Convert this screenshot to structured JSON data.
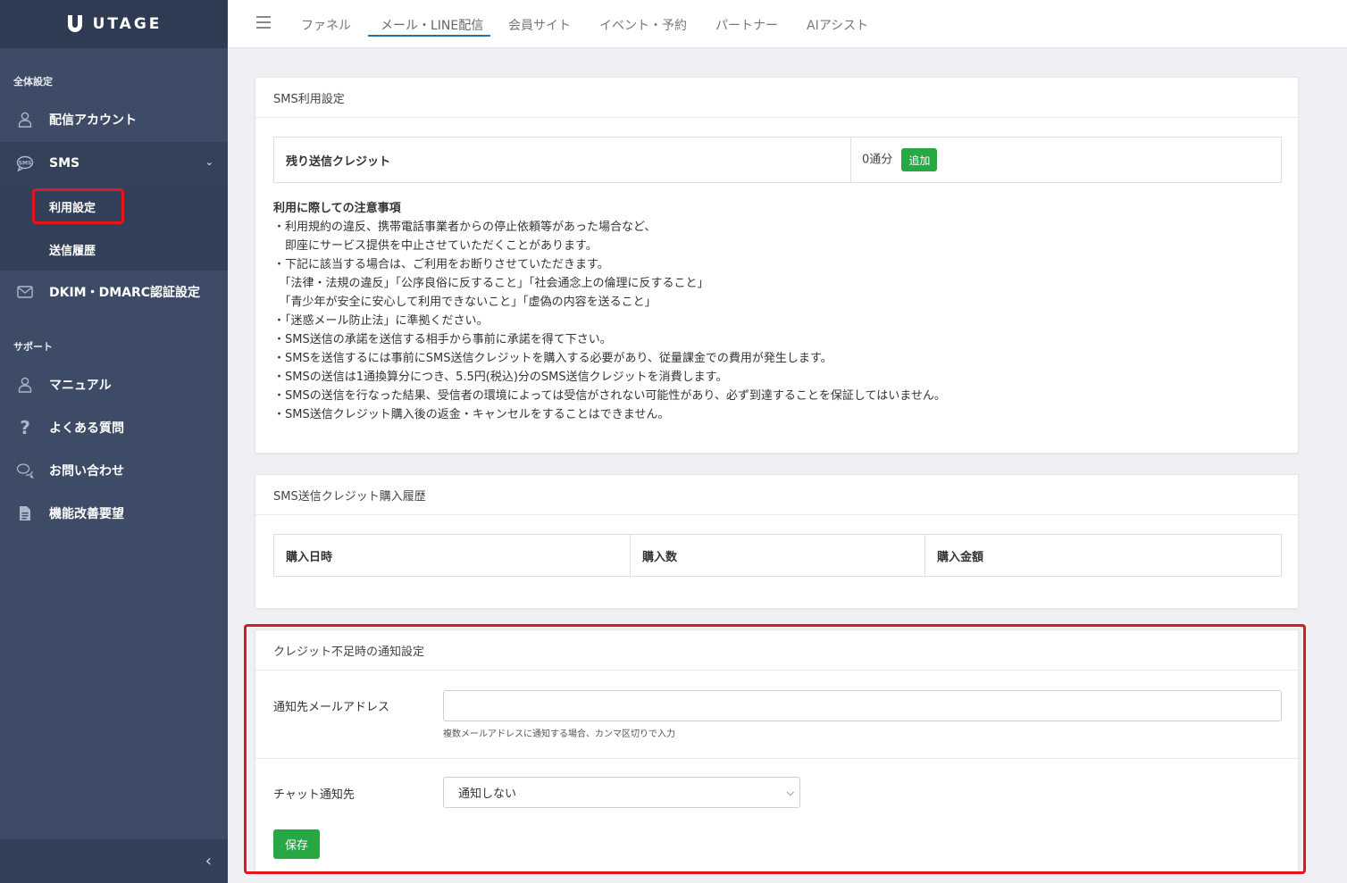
{
  "app": {
    "logo_text": "UTAGE"
  },
  "sidebar": {
    "section_general": "全体設定",
    "delivery_account": "配信アカウント",
    "sms": "SMS",
    "sms_settings": "利用設定",
    "sms_history": "送信履歴",
    "dkim": "DKIM・DMARC認証設定",
    "section_support": "サポート",
    "manual": "マニュアル",
    "faq": "よくある質問",
    "contact": "お問い合わせ",
    "feature_request": "機能改善要望"
  },
  "topnav": {
    "tabs": [
      "ファネル",
      "メール・LINE配信",
      "会員サイト",
      "イベント・予約",
      "パートナー",
      "AIアシスト"
    ],
    "active_index": 1
  },
  "sms_settings": {
    "header": "SMS利用設定",
    "credit_label": "残り送信クレジット",
    "credit_value": "0通分",
    "add_button": "追加",
    "notes_title": "利用に際しての注意事項",
    "notes": [
      "・利用規約の違反、携帯電話事業者からの停止依頼等があった場合など、",
      "　即座にサービス提供を中止させていただくことがあります。",
      "・下記に該当する場合は、ご利用をお断りさせていただきます。",
      "　「法律・法規の違反」「公序良俗に反すること」「社会通念上の倫理に反すること」",
      "　「青少年が安全に安心して利用できないこと」「虚偽の内容を送ること」",
      "・「迷惑メール防止法」に準拠ください。",
      "・SMS送信の承諾を送信する相手から事前に承諾を得て下さい。",
      "・SMSを送信するには事前にSMS送信クレジットを購入する必要があり、従量課金での費用が発生します。",
      "・SMSの送信は1通換算分につき、5.5円(税込)分のSMS送信クレジットを消費します。",
      "・SMSの送信を行なった結果、受信者の環境によっては受信がされない可能性があり、必ず到達することを保証してはいません。",
      "・SMS送信クレジット購入後の返金・キャンセルをすることはできません。"
    ]
  },
  "purchase_history": {
    "header": "SMS送信クレジット購入履歴",
    "columns": [
      "購入日時",
      "購入数",
      "購入金額"
    ]
  },
  "notification": {
    "header": "クレジット不足時の通知設定",
    "email_label": "通知先メールアドレス",
    "email_value": "",
    "email_help": "複数メールアドレスに通知する場合、カンマ区切りで入力",
    "chat_label": "チャット通知先",
    "chat_selected": "通知しない",
    "save_button": "保存"
  },
  "colors": {
    "sidebar": "#3d4b66",
    "accent_green": "#28a745",
    "highlight_red": "#e3161e"
  }
}
